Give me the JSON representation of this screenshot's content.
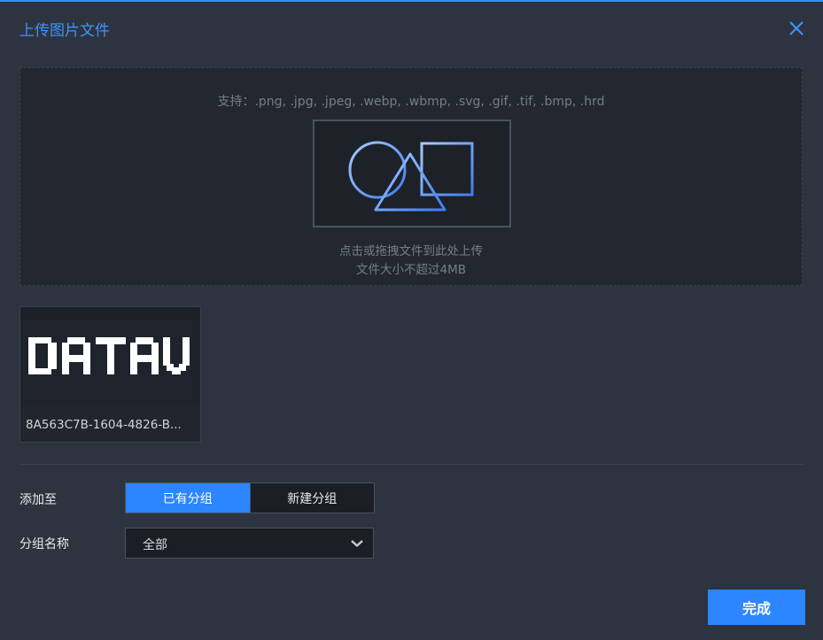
{
  "dialog": {
    "title": "上传图片文件",
    "close_icon": "close-icon"
  },
  "dropzone": {
    "supported_formats": "支持：.png, .jpg, .jpeg, .webp, .wbmp, .svg, .gif, .tif, .bmp, .hrd",
    "illustration_icon": "shapes-icon",
    "hint_line1": "点击或拖拽文件到此处上传",
    "hint_line2": "文件大小不超过4MB"
  },
  "files": [
    {
      "name": "8A563C7B-1604-4826-B...",
      "preview_text": "DATAV"
    }
  ],
  "form": {
    "add_to_label": "添加至",
    "segments": [
      {
        "label": "已有分组",
        "active": true
      },
      {
        "label": "新建分组",
        "active": false
      }
    ],
    "group_name_label": "分组名称",
    "group_select_value": "全部",
    "dropdown_icon": "chevron-down-icon"
  },
  "footer": {
    "done_label": "完成"
  },
  "colors": {
    "accent": "#2b86ff",
    "background": "#2e343f",
    "panel": "#232830"
  }
}
